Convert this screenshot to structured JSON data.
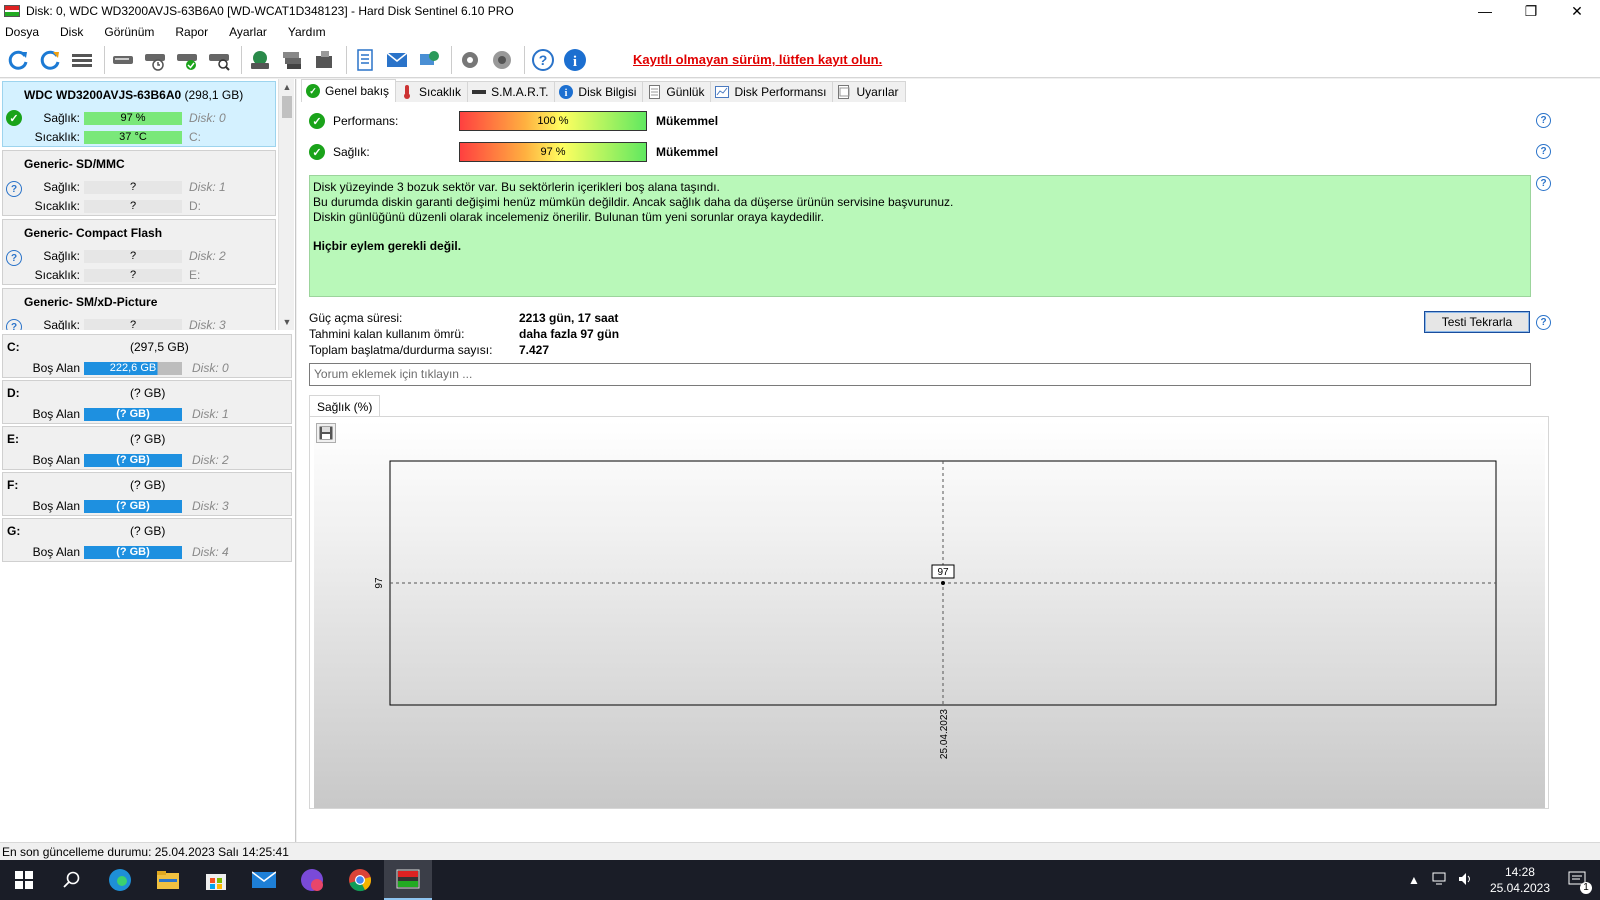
{
  "window": {
    "title": "Disk: 0, WDC WD3200AVJS-63B6A0 [WD-WCAT1D348123]  -  Hard Disk Sentinel 6.10 PRO",
    "minimize": "—",
    "maximize": "❐",
    "close": "✕"
  },
  "menu": [
    "Dosya",
    "Disk",
    "Görünüm",
    "Rapor",
    "Ayarlar",
    "Yardım"
  ],
  "toolbar": {
    "warning": "Kayıtlı olmayan sürüm, lütfen kayıt olun."
  },
  "disks": [
    {
      "name": "WDC WD3200AVJS-63B6A0",
      "capacity": "(298,1 GB)",
      "health_label": "Sağlık:",
      "health": "97 %",
      "disk_no": "Disk: 0",
      "temp_label": "Sıcaklık:",
      "temp": "37 °C",
      "drive": "C:",
      "status": "ok"
    },
    {
      "name": "Generic- SD/MMC",
      "capacity": "",
      "health_label": "Sağlık:",
      "health": "?",
      "disk_no": "Disk: 1",
      "temp_label": "Sıcaklık:",
      "temp": "?",
      "drive": "D:",
      "status": "unknown"
    },
    {
      "name": "Generic- Compact Flash",
      "capacity": "",
      "health_label": "Sağlık:",
      "health": "?",
      "disk_no": "Disk: 2",
      "temp_label": "Sıcaklık:",
      "temp": "?",
      "drive": "E:",
      "status": "unknown"
    },
    {
      "name": "Generic- SM/xD-Picture",
      "capacity": "",
      "health_label": "Sağlık:",
      "health": "?",
      "disk_no": "Disk: 3",
      "temp_label": "Sıcaklık:",
      "temp": "",
      "drive": "",
      "status": "unknown"
    }
  ],
  "volumes": [
    {
      "letter": "C:",
      "capacity": "(297,5 GB)",
      "free_label": "Boş Alan",
      "free": "222,6 GB",
      "disk_no": "Disk: 0",
      "free_fraction": 0.75
    },
    {
      "letter": "D:",
      "capacity": "(? GB)",
      "free_label": "Boş Alan",
      "free": "(? GB)",
      "disk_no": "Disk: 1"
    },
    {
      "letter": "E:",
      "capacity": "(? GB)",
      "free_label": "Boş Alan",
      "free": "(? GB)",
      "disk_no": "Disk: 2"
    },
    {
      "letter": "F:",
      "capacity": "(? GB)",
      "free_label": "Boş Alan",
      "free": "(? GB)",
      "disk_no": "Disk: 3"
    },
    {
      "letter": "G:",
      "capacity": "(? GB)",
      "free_label": "Boş Alan",
      "free": "(? GB)",
      "disk_no": "Disk: 4"
    }
  ],
  "tabs": [
    "Genel bakış",
    "Sıcaklık",
    "S.M.A.R.T.",
    "Disk Bilgisi",
    "Günlük",
    "Disk Performansı",
    "Uyarılar"
  ],
  "overview": {
    "performance_label": "Performans:",
    "performance_value": "100 %",
    "performance_fraction": 1.0,
    "performance_result": "Mükemmel",
    "health_label": "Sağlık:",
    "health_value": "97 %",
    "health_fraction": 0.97,
    "health_result": "Mükemmel",
    "summary_lines": [
      "Disk yüzeyinde 3 bozuk sektör var. Bu sektörlerin içerikleri boş alana taşındı.",
      "Bu durumda diskin garanti değişimi henüz mümkün değildir. Ancak sağlık daha da düşerse ürünün servisine başvurunuz.",
      "Diskin günlüğünü düzenli olarak incelemeniz önerilir. Bulunan tüm yeni sorunlar oraya kaydedilir."
    ],
    "summary_action": "Hiçbir eylem gerekli değil.",
    "power_on_label": "Güç açma süresi:",
    "power_on_value": "2213 gün, 17 saat",
    "lifetime_label": "Tahmini kalan kullanım ömrü:",
    "lifetime_value": "daha fazla 97 gün",
    "startstop_label": "Toplam başlatma/durdurma sayısı:",
    "startstop_value": "7.427",
    "retest_button": "Testi Tekrarla",
    "comment_placeholder": "Yorum eklemek için tıklayın ..."
  },
  "chart_tab": "Sağlık (%)",
  "chart_data": {
    "type": "line",
    "x": [
      "25.04.2023"
    ],
    "series": [
      {
        "values": [
          97
        ]
      }
    ],
    "ytick_labels": [
      "97"
    ],
    "xtick_labels": [
      "25.04.2023"
    ],
    "data_labels": [
      "97"
    ],
    "grid": true
  },
  "statusbar": "En son güncelleme durumu: 25.04.2023 Salı 14:25:41",
  "taskbar": {
    "time": "14:28",
    "date": "25.04.2023",
    "notifications": "1"
  }
}
